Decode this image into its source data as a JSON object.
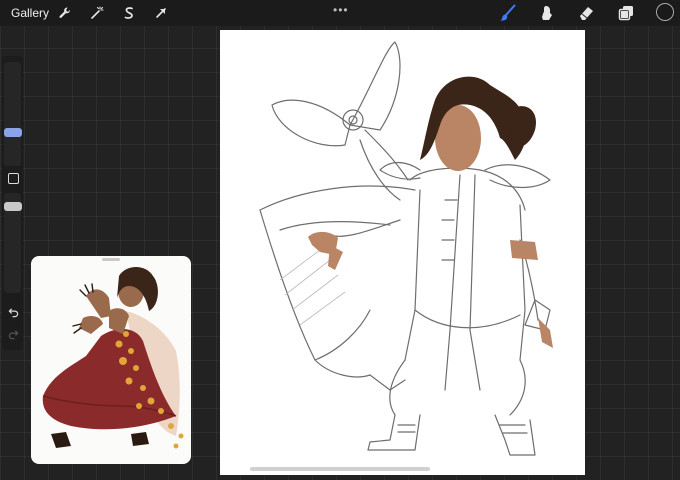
{
  "topbar": {
    "gallery_label": "Gallery",
    "left_tools": [
      {
        "icon": "wrench-icon"
      },
      {
        "icon": "magic-wand-icon"
      },
      {
        "icon": "selection-s-icon"
      },
      {
        "icon": "transform-arrow-icon"
      }
    ],
    "menu_dots": "•••",
    "right_tools": [
      {
        "icon": "brush-icon",
        "active": true
      },
      {
        "icon": "smudge-icon",
        "active": false
      },
      {
        "icon": "eraser-icon",
        "active": false
      },
      {
        "icon": "layers-icon",
        "active": false
      }
    ],
    "current_color": "#1a1a1a"
  },
  "sidebar": {
    "size_slider_color": "#8aa3e6",
    "opacity_slider_color": "#c8c8c8",
    "modify_button_icon": "square-icon",
    "undo_icon": "undo-arrow-icon",
    "redo_icon": "redo-arrow-icon"
  },
  "colors": {
    "accent": "#3b7bff",
    "background": "#222222",
    "topbar": "#1b1b1b",
    "canvas": "#ffffff",
    "skin": "#b98564",
    "hair": "#3b2418",
    "dress": "#8b2a2a",
    "gold": "#e0a63a"
  }
}
